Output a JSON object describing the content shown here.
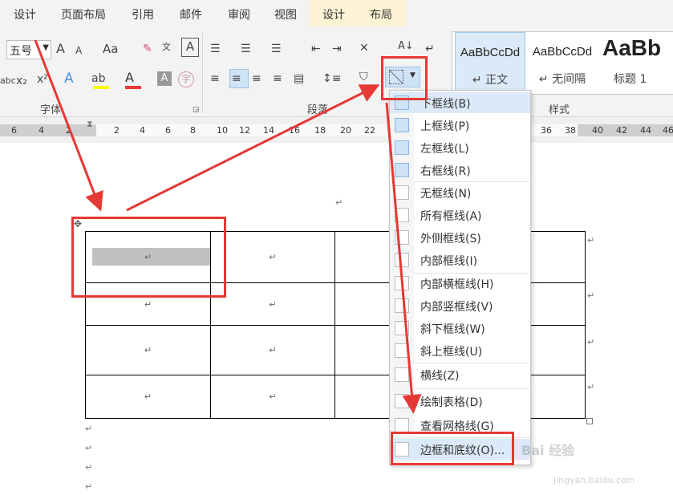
{
  "tabs": [
    "设计",
    "页面布局",
    "引用",
    "邮件",
    "审阅",
    "视图",
    "设计",
    "布局"
  ],
  "font": {
    "size_value": "五号",
    "grow_icon": "A",
    "shrink_icon": "A",
    "case_label": "Aa",
    "group_label": "字体"
  },
  "paragraph": {
    "group_label": "段落"
  },
  "styles": {
    "group_label": "样式",
    "items": [
      {
        "sample": "AaBbCcDd",
        "name": "↵ 正文"
      },
      {
        "sample": "AaBbCcDd",
        "name": "↵ 无间隔"
      },
      {
        "sample": "AaBb",
        "name": "标题 1"
      }
    ]
  },
  "ruler": {
    "ticks": [
      "6",
      "4",
      "2",
      "2",
      "4",
      "6",
      "8",
      "10",
      "12",
      "14",
      "16",
      "18",
      "20",
      "22",
      "36",
      "38",
      "40",
      "42",
      "44",
      "46"
    ]
  },
  "table": {
    "rows": 4,
    "cols": 4,
    "cell_mark": "↵"
  },
  "para_mark": "↵",
  "border_menu": {
    "items": [
      {
        "label": "下框线(B)",
        "icon": "bottom-border-icon"
      },
      {
        "label": "上框线(P)",
        "icon": "top-border-icon"
      },
      {
        "label": "左框线(L)",
        "icon": "left-border-icon"
      },
      {
        "label": "右框线(R)",
        "icon": "right-border-icon"
      },
      {
        "label": "无框线(N)",
        "icon": "no-border-icon"
      },
      {
        "label": "所有框线(A)",
        "icon": "all-borders-icon"
      },
      {
        "label": "外侧框线(S)",
        "icon": "outside-borders-icon"
      },
      {
        "label": "内部框线(I)",
        "icon": "inside-borders-icon"
      },
      {
        "label": "内部横框线(H)",
        "icon": "inside-horizontal-border-icon"
      },
      {
        "label": "内部竖框线(V)",
        "icon": "inside-vertical-border-icon"
      },
      {
        "label": "斜下框线(W)",
        "icon": "diagonal-down-border-icon"
      },
      {
        "label": "斜上框线(U)",
        "icon": "diagonal-up-border-icon"
      },
      {
        "label": "横线(Z)",
        "icon": "horizontal-line-icon"
      },
      {
        "label": "绘制表格(D)",
        "icon": "draw-table-icon"
      },
      {
        "label": "查看网格线(G)",
        "icon": "view-gridlines-icon"
      },
      {
        "label": "边框和底纹(O)...",
        "icon": "borders-shading-icon"
      }
    ]
  },
  "watermark": {
    "brand": "Bai 经验",
    "url": "jingyan.baidu.com"
  },
  "colors": {
    "accent_red": "#e53935",
    "highlight_blue": "#cfe3f7",
    "tab_active": "#f0c000"
  }
}
